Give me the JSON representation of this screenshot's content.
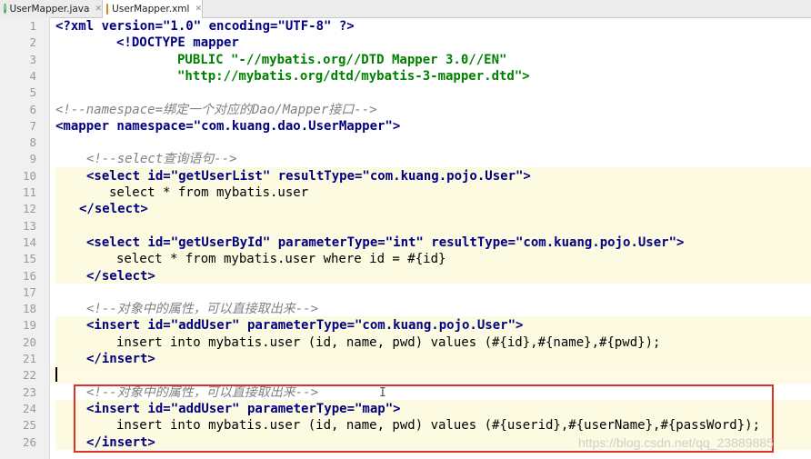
{
  "tabs": [
    {
      "label": "UserMapper.java",
      "icon": "java-class-icon"
    },
    {
      "label": "UserMapper.xml",
      "icon": "xml-file-icon"
    }
  ],
  "code": {
    "l1": "<?xml version=\"1.0\" encoding=\"UTF-8\" ?>",
    "l2": "<!DOCTYPE mapper",
    "l3": "PUBLIC \"-//mybatis.org//DTD Mapper 3.0//EN\"",
    "l4": "\"http://mybatis.org/dtd/mybatis-3-mapper.dtd\">",
    "l6": "<!--namespace=绑定一个对应的Dao/Mapper接口-->",
    "l7": "<mapper namespace=\"com.kuang.dao.UserMapper\">",
    "l9": "<!--select查询语句-->",
    "l10": "<select id=\"getUserList\" resultType=\"com.kuang.pojo.User\">",
    "l11": "select * from mybatis.user",
    "l12": "</select>",
    "l14": "<select id=\"getUserById\" parameterType=\"int\" resultType=\"com.kuang.pojo.User\">",
    "l15": "select * from mybatis.user where id = #{id}",
    "l16": "</select>",
    "l18": "<!--对象中的属性，可以直接取出来-->",
    "l19": "<insert id=\"addUser\" parameterType=\"com.kuang.pojo.User\">",
    "l20": "insert into mybatis.user (id, name, pwd) values (#{id},#{name},#{pwd});",
    "l21": "</insert>",
    "l23": "<!--对象中的属性，可以直接取出来-->",
    "l24": "<insert id=\"addUser\" parameterType=\"map\">",
    "l25": "insert into mybatis.user (id, name, pwd) values (#{userid},#{userName},#{passWord});",
    "l26": "</insert>"
  },
  "watermark": "https://blog.csdn.net/qq_23889885",
  "colors": {
    "highlight_box": "#e0302a",
    "tag": "#000080",
    "attr": "#0000ff",
    "string": "#008000",
    "comment": "#808080"
  }
}
